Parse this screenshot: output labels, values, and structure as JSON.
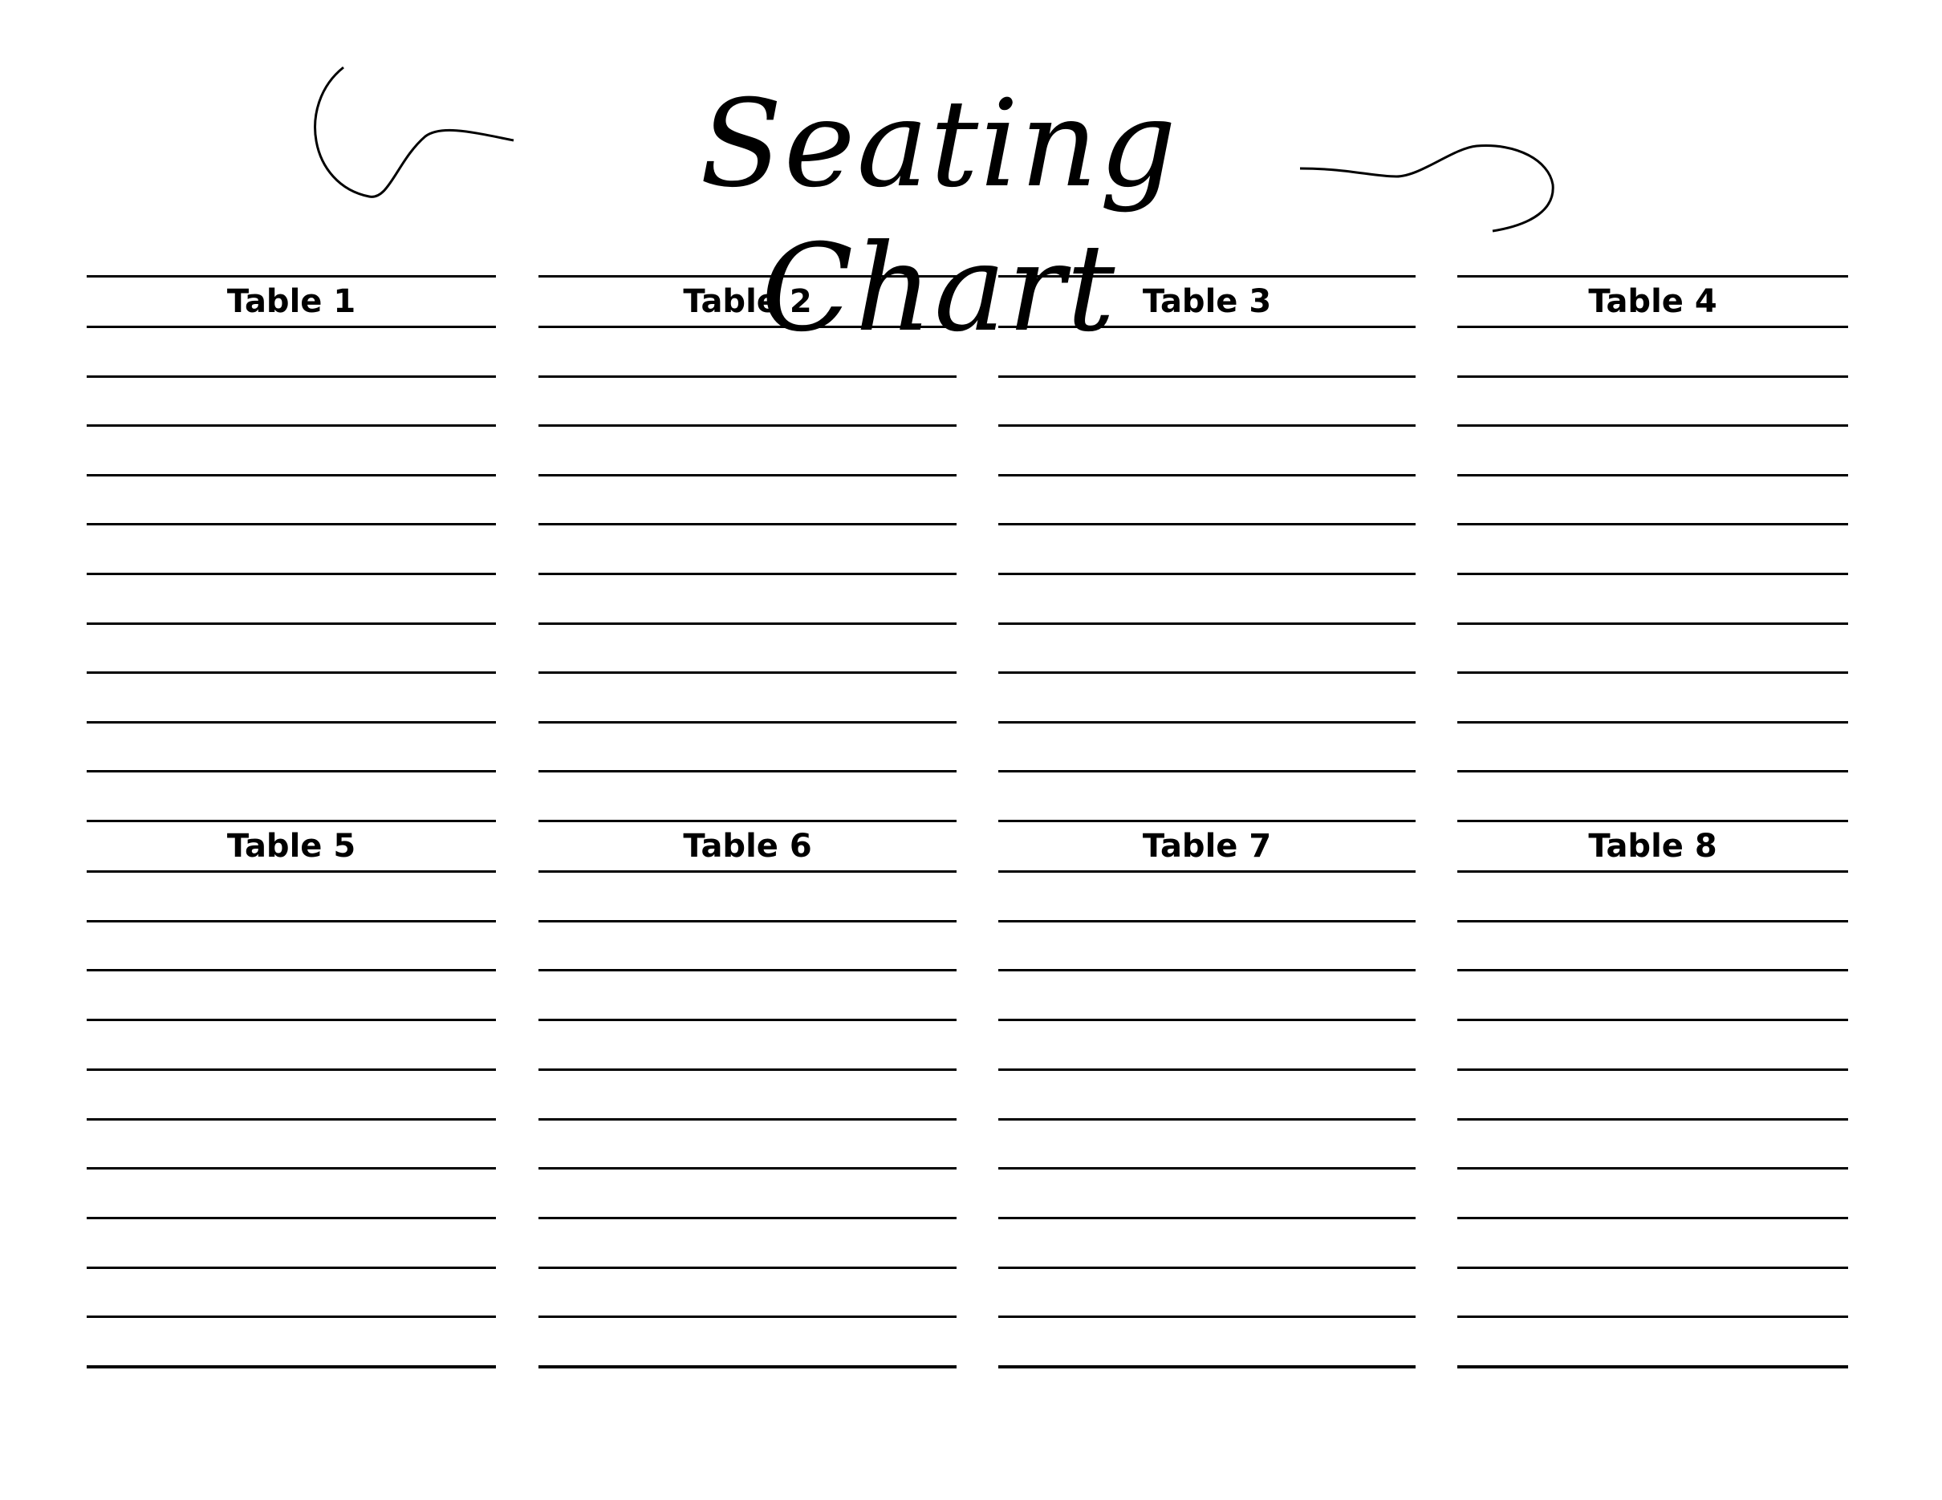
{
  "title": "Seating Chart",
  "tables": [
    {
      "label": "Table 1",
      "seats": 10
    },
    {
      "label": "Table 2",
      "seats": 10
    },
    {
      "label": "Table 3",
      "seats": 10
    },
    {
      "label": "Table 4",
      "seats": 10
    },
    {
      "label": "Table 5",
      "seats": 10
    },
    {
      "label": "Table 6",
      "seats": 10
    },
    {
      "label": "Table 7",
      "seats": 10
    },
    {
      "label": "Table 8",
      "seats": 10
    }
  ],
  "colors": {
    "ink": "#000000",
    "background": "#ffffff"
  }
}
